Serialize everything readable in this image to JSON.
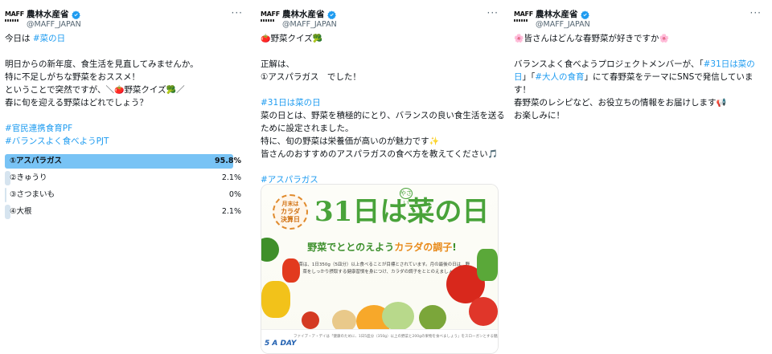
{
  "account": {
    "name": "農林水産省",
    "handle": "@MAFF_JAPAN",
    "avatar_text": "MAFF",
    "more_label": "···"
  },
  "tweet1": {
    "lines": [
      {
        "parts": [
          {
            "t": "今日は "
          },
          {
            "t": "#菜の日",
            "link": true
          }
        ]
      },
      {
        "gap": true
      },
      {
        "parts": [
          {
            "t": "明日からの新年度、食生活を見直してみませんか。"
          }
        ]
      },
      {
        "parts": [
          {
            "t": "特に不足しがちな野菜をおススメ！"
          }
        ]
      },
      {
        "parts": [
          {
            "t": "ということで突然ですが、＼"
          },
          {
            "t": "🍅",
            "emoji": true
          },
          {
            "t": "野菜クイズ"
          },
          {
            "t": "🥦",
            "emoji": true
          },
          {
            "t": "／"
          }
        ]
      },
      {
        "parts": [
          {
            "t": "春に旬を迎える野菜はどれでしょう？"
          }
        ]
      },
      {
        "gap": true
      },
      {
        "parts": [
          {
            "t": "#官民連携食育PF",
            "link": true
          }
        ]
      },
      {
        "parts": [
          {
            "t": "#バランスよく食べようPJT",
            "link": true
          }
        ]
      }
    ],
    "poll": [
      {
        "label": "①アスパラガス",
        "pct": "95.8%",
        "value": 95.8,
        "winner": true
      },
      {
        "label": "②きゅうり",
        "pct": "2.1%",
        "value": 2.1,
        "winner": false
      },
      {
        "label": "③さつまいも",
        "pct": "0%",
        "value": 0,
        "winner": false
      },
      {
        "label": "④大根",
        "pct": "2.1%",
        "value": 2.1,
        "winner": false
      }
    ]
  },
  "tweet2": {
    "lines": [
      {
        "parts": [
          {
            "t": "🍅",
            "emoji": true
          },
          {
            "t": "野菜クイズ"
          },
          {
            "t": "🥦",
            "emoji": true
          }
        ]
      },
      {
        "gap": true
      },
      {
        "parts": [
          {
            "t": "正解は、"
          }
        ]
      },
      {
        "parts": [
          {
            "t": "①アスパラガス　でした！"
          }
        ]
      },
      {
        "gap": true
      },
      {
        "parts": [
          {
            "t": "#31日は菜の日",
            "link": true
          }
        ]
      },
      {
        "parts": [
          {
            "t": "菜の日とは、野菜を積極的にとり、バランスの良い食生活を送る"
          }
        ]
      },
      {
        "parts": [
          {
            "t": "ために設定されました。"
          }
        ]
      },
      {
        "parts": [
          {
            "t": "特に、旬の野菜は栄養価が高いのが魅力です"
          },
          {
            "t": "✨",
            "emoji": true
          }
        ]
      },
      {
        "parts": [
          {
            "t": "皆さんのおすすめのアスパラガスの食べ方を教えてください"
          },
          {
            "t": "🎵",
            "emoji": true
          }
        ]
      },
      {
        "gap": true
      },
      {
        "parts": [
          {
            "t": "#アスパラガス",
            "link": true
          }
        ]
      }
    ],
    "card": {
      "badge_lines": [
        "月末は",
        "カラダ",
        "決算日"
      ],
      "title_num": "31日は",
      "title_kanji": "菜",
      "title_tail": "の日",
      "furigana": "やさい",
      "subtitle_a": "野菜でととのえよう",
      "subtitle_b": "カラダの調子",
      "subtitle_c": "!",
      "desc": "野菜は、1日350g（5皿分）以上食べることが目標とされています。月の最後の日は、野菜をしっかり摂取する健康習慣を身につけ、カラダの調子をととのえましょう。",
      "footer": "ファイブ・ア・デイは「健康のために、1日5皿分（350g）以上の野菜と200gの果物を食べましょう」をスローガンとする健康増進運動です。",
      "logo": "5 A DAY"
    }
  },
  "tweet3": {
    "lines": [
      {
        "parts": [
          {
            "t": "🌸",
            "emoji": true
          },
          {
            "t": "皆さんはどんな春野菜が好きですか"
          },
          {
            "t": "🌸",
            "emoji": true
          }
        ]
      },
      {
        "gap": true
      },
      {
        "parts": [
          {
            "t": "バランスよく食べようプロジェクトメンバーが、「"
          },
          {
            "t": "#31日は菜の",
            "link": true
          }
        ]
      },
      {
        "parts": [
          {
            "t": "日",
            "link": true
          },
          {
            "t": "」「"
          },
          {
            "t": "#大人の食育",
            "link": true
          },
          {
            "t": "」にて春野菜をテーマにSNSで発信していま"
          }
        ]
      },
      {
        "parts": [
          {
            "t": "す！"
          }
        ]
      },
      {
        "parts": [
          {
            "t": "春野菜のレシピなど、お役立ちの情報をお届けします"
          },
          {
            "t": "📢",
            "emoji": true
          }
        ]
      },
      {
        "parts": [
          {
            "t": "お楽しみに！"
          }
        ]
      }
    ]
  },
  "colors": {
    "link": "#1d9bf0",
    "poll_winner": "#78c3f5",
    "poll_other": "#d6e4ef",
    "brand_green": "#49a33a",
    "verified": "#1d9bf0"
  },
  "icons": [
    "verified-badge-icon",
    "more-options-icon",
    "maff-logo-icon"
  ]
}
